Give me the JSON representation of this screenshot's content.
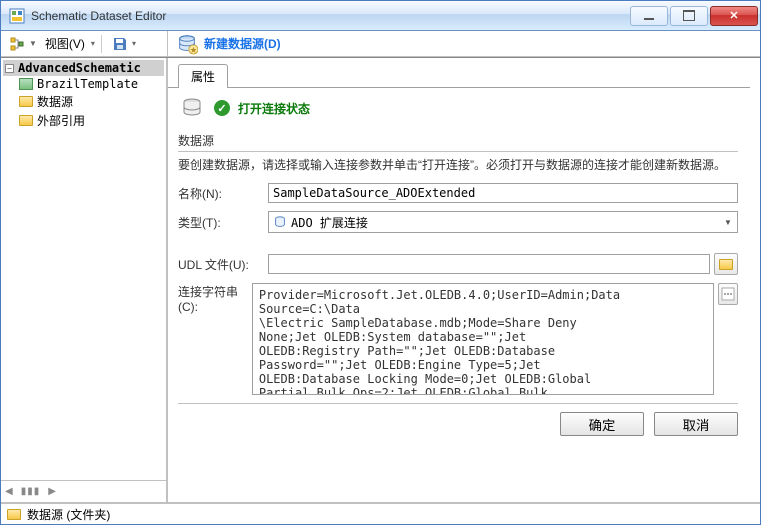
{
  "window": {
    "title": "Schematic Dataset Editor"
  },
  "toolbar": {
    "view_menu": "视图(V)",
    "new_datasource": "新建数据源(D)"
  },
  "tree": {
    "root": "AdvancedSchematic",
    "items": [
      "BrazilTemplate",
      "数据源",
      "外部引用"
    ]
  },
  "tabs": {
    "active": "属性"
  },
  "status": {
    "text": "打开连接状态"
  },
  "section": {
    "title": "数据源",
    "desc": "要创建数据源，请选择或输入连接参数并单击“打开连接”。必须打开与数据源的连接才能创建新数据源。"
  },
  "form": {
    "name_label": "名称(N):",
    "name_value": "SampleDataSource_ADOExtended",
    "type_label": "类型(T):",
    "type_value": "ADO 扩展连接",
    "udl_label": "UDL 文件(U):",
    "udl_value": "",
    "conn_label": "连接字符串(C):",
    "conn_value": "Provider=Microsoft.Jet.OLEDB.4.0;UserID=Admin;Data\nSource=C:\\Data\n\\Electric SampleDatabase.mdb;Mode=Share Deny\nNone;Jet OLEDB:System database=\"\";Jet\nOLEDB:Registry Path=\"\";Jet OLEDB:Database\nPassword=\"\";Jet OLEDB:Engine Type=5;Jet\nOLEDB:Database Locking Mode=0;Jet OLEDB:Global\nPartial Bulk Ops=2;Jet OLEDB:Global Bulk"
  },
  "buttons": {
    "ok": "确定",
    "cancel": "取消"
  },
  "statusbar": {
    "text": "数据源 (文件夹)"
  }
}
